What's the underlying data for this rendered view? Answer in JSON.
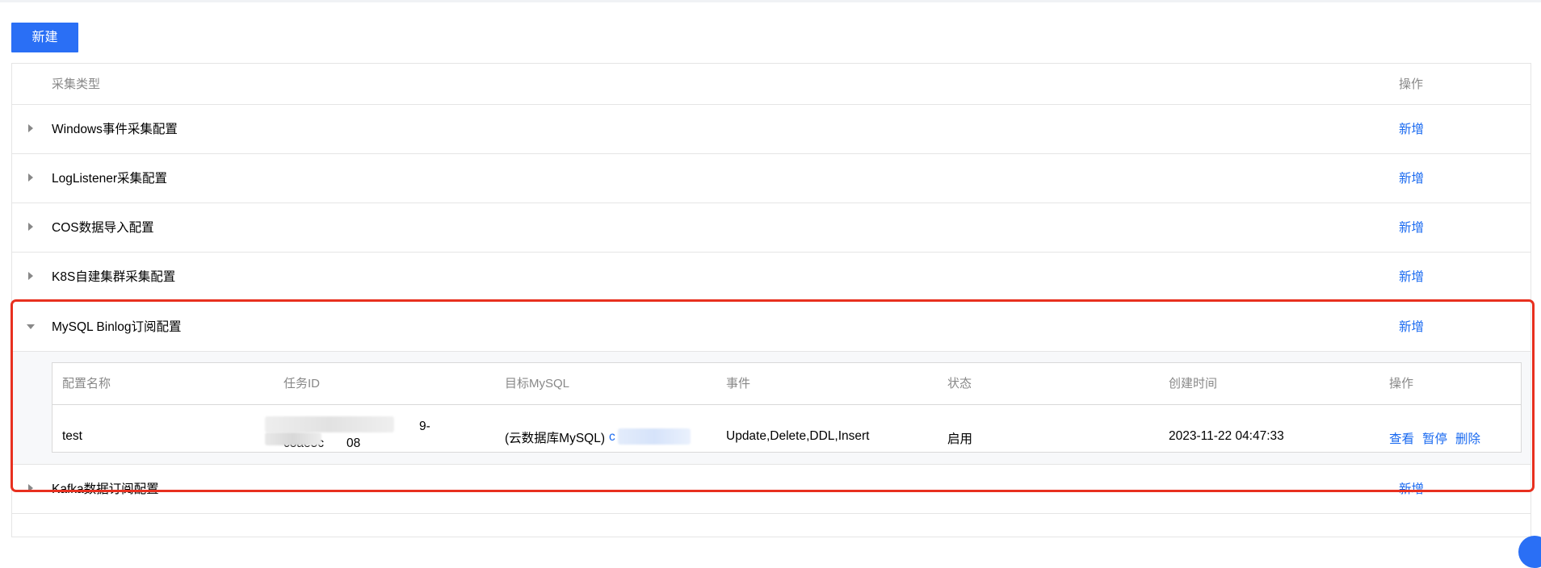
{
  "toolbar": {
    "new_label": "新建"
  },
  "table": {
    "headers": {
      "type": "采集类型",
      "action": "操作"
    },
    "rows": [
      {
        "label": "Windows事件采集配置",
        "action": "新增",
        "expanded": false
      },
      {
        "label": "LogListener采集配置",
        "action": "新增",
        "expanded": false
      },
      {
        "label": "COS数据导入配置",
        "action": "新增",
        "expanded": false
      },
      {
        "label": "K8S自建集群采集配置",
        "action": "新增",
        "expanded": false
      },
      {
        "label": "MySQL Binlog订阅配置",
        "action": "新增",
        "expanded": true
      },
      {
        "label": "Kafka数据订阅配置",
        "action": "新增",
        "expanded": false
      }
    ]
  },
  "binlog": {
    "headers": [
      "配置名称",
      "任务ID",
      "目标MySQL",
      "事件",
      "状态",
      "创建时间",
      "操作"
    ],
    "row": {
      "name": "test",
      "task_id_line1": "7a",
      "task_id_line1_end": "9-",
      "task_id_line2": "c8ae5c",
      "task_id_line2_end": "08",
      "target_prefix": "(云数据库MySQL)",
      "target_link": "c",
      "events": "Update,Delete,DDL,Insert",
      "status": "启用",
      "created": "2023-11-22 04:47:33",
      "actions": {
        "view": "查看",
        "pause": "暂停",
        "delete": "删除"
      }
    }
  },
  "colors": {
    "primary": "#2a6ff5",
    "link": "#1a6af0",
    "highlight": "#e8301f"
  }
}
